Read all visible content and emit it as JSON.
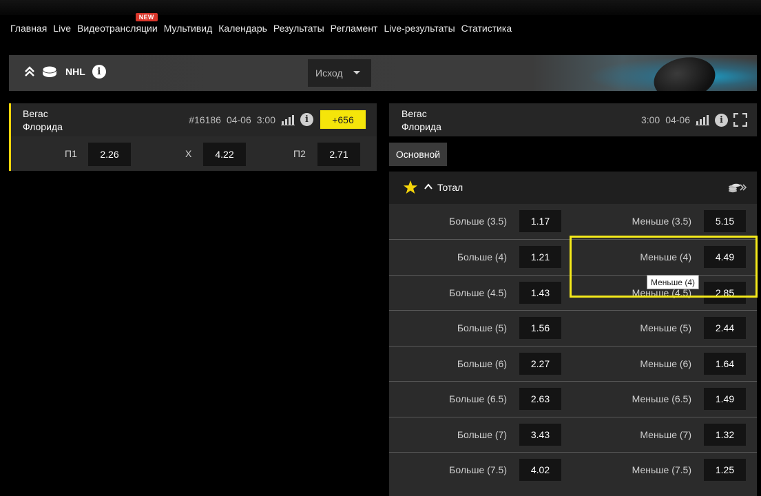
{
  "nav": {
    "items": [
      "Главная",
      "Live",
      "Видеотрансляции",
      "Мультивид",
      "Календарь",
      "Результаты",
      "Регламент",
      "Live-результаты",
      "Статистика"
    ],
    "badge": "NEW"
  },
  "league": {
    "name": "NHL",
    "select_value": "Исход"
  },
  "match": {
    "team1": "Вегас",
    "team2": "Флорида",
    "id": "#16186",
    "date": "04-06",
    "time": "3:00",
    "more_markets": "+656",
    "outcomes": [
      {
        "label": "П1",
        "odd": "2.26"
      },
      {
        "label": "X",
        "odd": "4.22"
      },
      {
        "label": "П2",
        "odd": "2.71"
      }
    ]
  },
  "detail": {
    "team1": "Вегас",
    "team2": "Флорида",
    "time": "3:00",
    "date": "04-06",
    "tab": "Основной",
    "market_title": "Тотал",
    "rows": [
      {
        "over": "Больше (3.5)",
        "over_odd": "1.17",
        "under": "Меньше (3.5)",
        "under_odd": "5.15"
      },
      {
        "over": "Больше (4)",
        "over_odd": "1.21",
        "under": "Меньше (4)",
        "under_odd": "4.49"
      },
      {
        "over": "Больше (4.5)",
        "over_odd": "1.43",
        "under": "Меньше (4.5)",
        "under_odd": "2.85"
      },
      {
        "over": "Больше (5)",
        "over_odd": "1.56",
        "under": "Меньше (5)",
        "under_odd": "2.44"
      },
      {
        "over": "Больше (6)",
        "over_odd": "2.27",
        "under": "Меньше (6)",
        "under_odd": "1.64"
      },
      {
        "over": "Больше (6.5)",
        "over_odd": "2.63",
        "under": "Меньше (6.5)",
        "under_odd": "1.49"
      },
      {
        "over": "Больше (7)",
        "over_odd": "3.43",
        "under": "Меньше (7)",
        "under_odd": "1.32"
      },
      {
        "over": "Больше (7.5)",
        "over_odd": "4.02",
        "under": "Меньше (7.5)",
        "under_odd": "1.25"
      }
    ],
    "tooltip": "Меньше (4)"
  },
  "colors": {
    "accent_yellow": "#f5e50a",
    "badge_red": "#d9362b",
    "odd_bg": "#141414"
  },
  "icons": [
    "collapse-chevrons-icon",
    "hockey-puck-icon",
    "info-icon",
    "stats-bars-icon",
    "expand-icon",
    "star-icon",
    "chevron-up-icon",
    "coins-icon",
    "caret-down-icon"
  ]
}
